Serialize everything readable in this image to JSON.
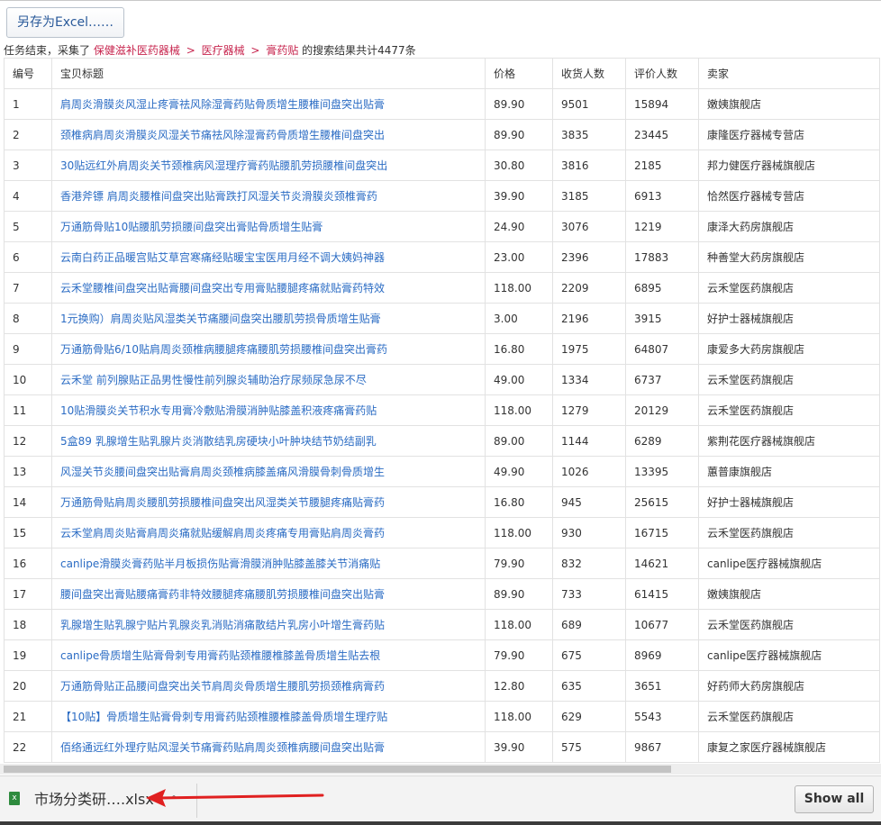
{
  "toolbar": {
    "export_label": "另存为Excel……"
  },
  "status": {
    "prefix": "任务结束，采集了",
    "crumbs": [
      "保健滋补医药器械",
      "医疗器械",
      "膏药贴"
    ],
    "sep": ">",
    "suffix": "的搜索结果共计4477条"
  },
  "table": {
    "headers": [
      "编号",
      "宝贝标题",
      "价格",
      "收货人数",
      "评价人数",
      "卖家"
    ],
    "rows": [
      [
        "1",
        "肩周炎滑膜炎风湿止疼膏祛风除湿膏药贴骨质增生腰椎间盘突出贴膏",
        "89.90",
        "9501",
        "15894",
        "嫩姨旗舰店"
      ],
      [
        "2",
        "颈椎病肩周炎滑膜炎风湿关节痛祛风除湿膏药骨质增生腰椎间盘突出",
        "89.90",
        "3835",
        "23445",
        "康隆医疗器械专营店"
      ],
      [
        "3",
        "30贴远红外肩周炎关节颈椎病风湿理疗膏药贴腰肌劳损腰椎间盘突出",
        "30.80",
        "3816",
        "2185",
        "邦力健医疗器械旗舰店"
      ],
      [
        "4",
        "香港斧镖 肩周炎腰椎间盘突出贴膏跌打风湿关节炎滑膜炎颈椎膏药",
        "39.90",
        "3185",
        "6913",
        "恰然医疗器械专营店"
      ],
      [
        "5",
        "万通筋骨贴10贴腰肌劳损腰间盘突出膏贴骨质增生贴膏",
        "24.90",
        "3076",
        "1219",
        "康泽大药房旗舰店"
      ],
      [
        "6",
        "云南白药正品暖宫贴艾草宫寒痛经贴暖宝宝医用月经不调大姨妈神器",
        "23.00",
        "2396",
        "17883",
        "种善堂大药房旗舰店"
      ],
      [
        "7",
        "云禾堂腰椎间盘突出贴膏腰间盘突出专用膏贴腰腿疼痛就贴膏药特效",
        "118.00",
        "2209",
        "6895",
        "云禾堂医药旗舰店"
      ],
      [
        "8",
        "1元换购）肩周炎贴风湿类关节痛腰间盘突出腰肌劳损骨质增生贴膏",
        "3.00",
        "2196",
        "3915",
        "好护士器械旗舰店"
      ],
      [
        "9",
        "万通筋骨贴6/10贴肩周炎颈椎病腰腿疼痛腰肌劳损腰椎间盘突出膏药",
        "16.80",
        "1975",
        "64807",
        "康爱多大药房旗舰店"
      ],
      [
        "10",
        "云禾堂 前列腺贴正品男性慢性前列腺炎辅助治疗尿频尿急尿不尽",
        "49.00",
        "1334",
        "6737",
        "云禾堂医药旗舰店"
      ],
      [
        "11",
        "10贴滑膜炎关节积水专用膏冷敷贴滑膜消肿贴膝盖积液疼痛膏药贴",
        "118.00",
        "1279",
        "20129",
        "云禾堂医药旗舰店"
      ],
      [
        "12",
        "5盒89 乳腺增生贴乳腺片炎消散结乳房硬块小叶肿块结节奶结副乳",
        "89.00",
        "1144",
        "6289",
        "紫荆花医疗器械旗舰店"
      ],
      [
        "13",
        "风湿关节炎腰间盘突出贴膏肩周炎颈椎病膝盖痛风滑膜骨刺骨质增生",
        "49.90",
        "1026",
        "13395",
        "蕙普康旗舰店"
      ],
      [
        "14",
        "万通筋骨贴肩周炎腰肌劳损腰椎间盘突出风湿类关节腰腿疼痛贴膏药",
        "16.80",
        "945",
        "25615",
        "好护士器械旗舰店"
      ],
      [
        "15",
        "云禾堂肩周炎贴膏肩周炎痛就贴缓解肩周炎疼痛专用膏贴肩周炎膏药",
        "118.00",
        "930",
        "16715",
        "云禾堂医药旗舰店"
      ],
      [
        "16",
        "canlipe滑膜炎膏药贴半月板损伤贴膏滑膜消肿贴膝盖膝关节消痛贴",
        "79.90",
        "832",
        "14621",
        "canlipe医疗器械旗舰店"
      ],
      [
        "17",
        "腰间盘突出膏贴腰痛膏药非特效腰腿疼痛腰肌劳损腰椎间盘突出贴膏",
        "89.90",
        "733",
        "61415",
        "嫩姨旗舰店"
      ],
      [
        "18",
        "乳腺增生贴乳腺宁贴片乳腺炎乳消贴消痛散结片乳房小叶增生膏药贴",
        "118.00",
        "689",
        "10677",
        "云禾堂医药旗舰店"
      ],
      [
        "19",
        "canlipe骨质增生贴膏骨刺专用膏药贴颈椎腰椎膝盖骨质增生贴去根",
        "79.90",
        "675",
        "8969",
        "canlipe医疗器械旗舰店"
      ],
      [
        "20",
        "万通筋骨贴正品腰间盘突出关节肩周炎骨质增生腰肌劳损颈椎病膏药",
        "12.80",
        "635",
        "3651",
        "好药师大药房旗舰店"
      ],
      [
        "21",
        "【10贴】骨质增生贴膏骨刺专用膏药贴颈椎腰椎膝盖骨质增生理疗贴",
        "118.00",
        "629",
        "5543",
        "云禾堂医药旗舰店"
      ],
      [
        "22",
        "佰络通远红外理疗贴风湿关节痛膏药贴肩周炎颈椎病腰间盘突出贴膏",
        "39.90",
        "575",
        "9867",
        "康复之家医疗器械旗舰店"
      ]
    ]
  },
  "download": {
    "file_name": "市场分类研….xlsx",
    "show_all_label": "Show all",
    "icon": "xlsx-file-icon"
  },
  "colors": {
    "link": "#2b6cc4",
    "crumb": "#c7254e",
    "annotation_arrow": "#e02020"
  }
}
